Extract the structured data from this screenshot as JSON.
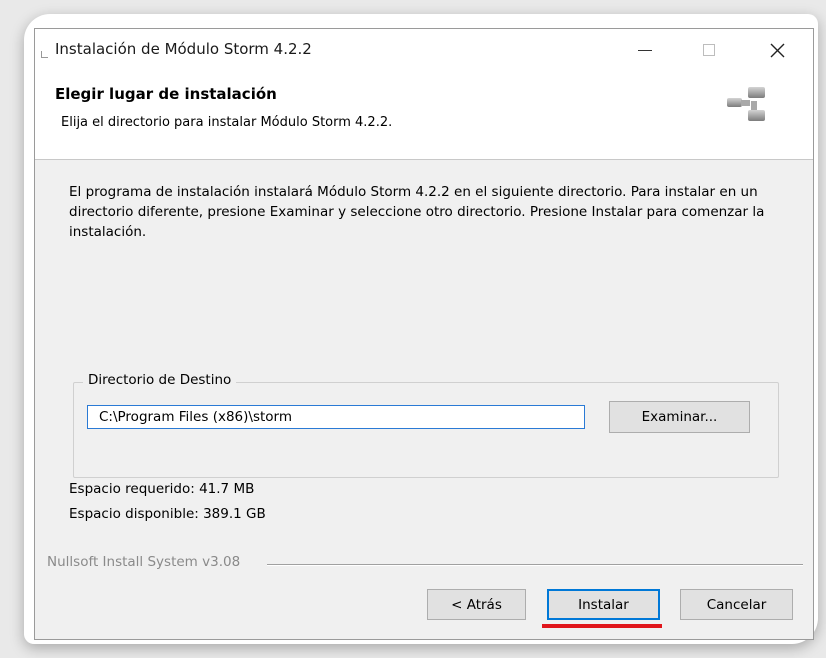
{
  "window": {
    "title": "Instalación de Módulo Storm 4.2.2",
    "controls": {
      "minimize": "—",
      "maximize": "",
      "close": "✕"
    }
  },
  "header": {
    "title": "Elegir lugar de instalación",
    "subtitle": "Elija el directorio para instalar Módulo Storm 4.2.2.",
    "icon": "installer-icon"
  },
  "body": {
    "intro": "El programa de instalación instalará Módulo Storm 4.2.2 en el siguiente directorio. Para instalar en un directorio diferente, presione Examinar y seleccione otro directorio. Presione Instalar para comenzar la instalación.",
    "destination_group_label": "Directorio de Destino",
    "destination_path": "C:\\Program Files (x86)\\storm",
    "browse_label": "Examinar...",
    "space_required": "Espacio requerido: 41.7 MB",
    "space_available": "Espacio disponible: 389.1 GB"
  },
  "footer": {
    "brand": "Nullsoft Install System v3.08",
    "back_label": "< Atrás",
    "install_label": "Instalar",
    "cancel_label": "Cancelar"
  },
  "colors": {
    "focus_border": "#0078d7",
    "annotation_underline": "#e0151b"
  }
}
